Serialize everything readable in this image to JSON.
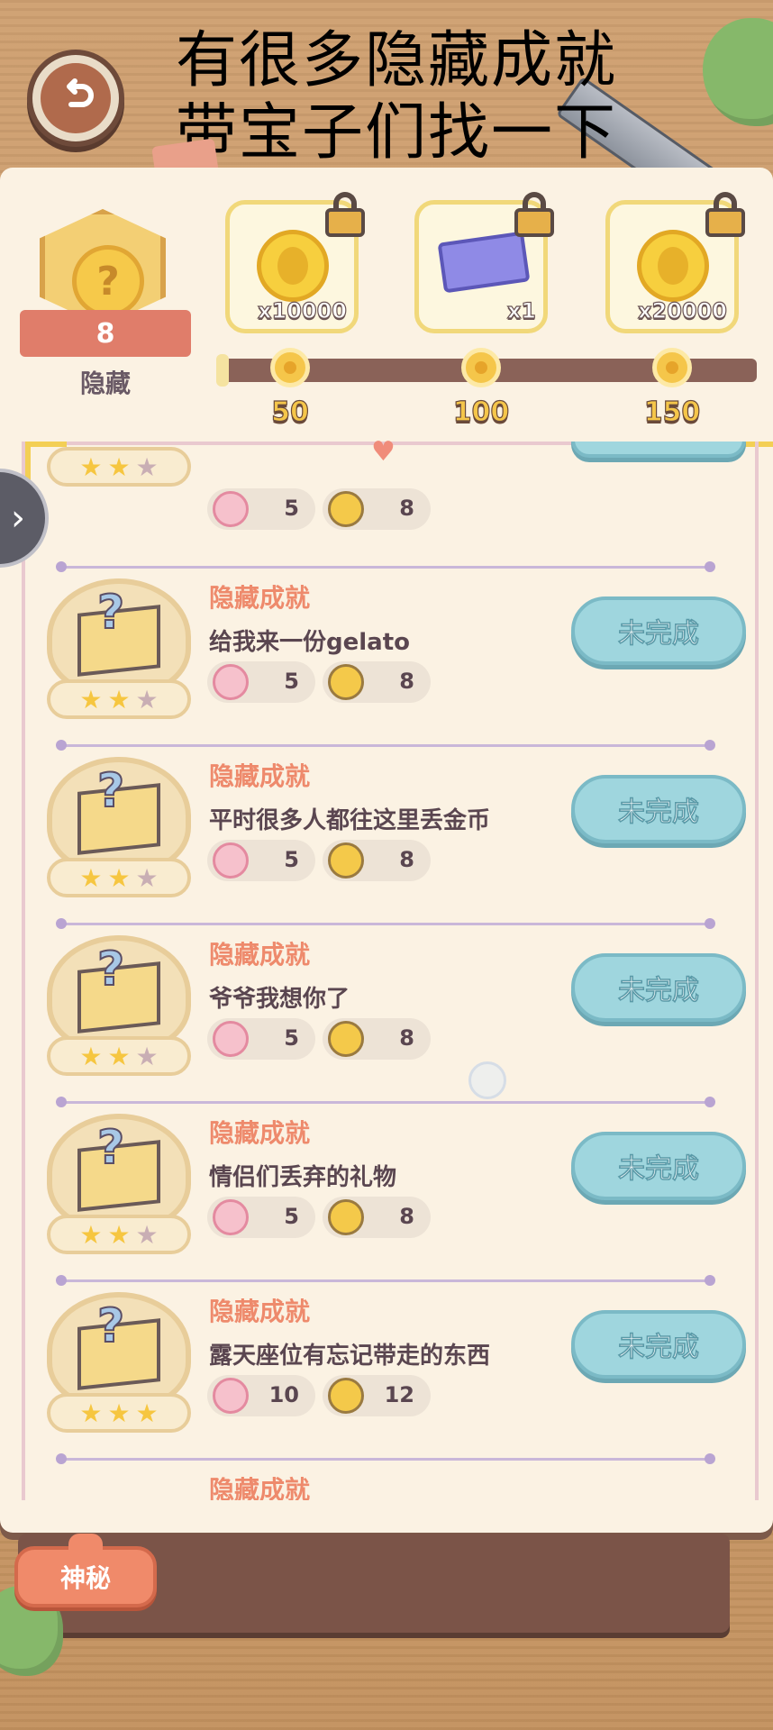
{
  "caption": {
    "line1": "有很多隐藏成就",
    "line2": "带宝子们找一下"
  },
  "badge": {
    "count": "8",
    "label": "隐藏"
  },
  "rewards": [
    {
      "qty": "x10000",
      "type": "coin",
      "locked": true
    },
    {
      "qty": "x1",
      "type": "ticket",
      "locked": true
    },
    {
      "qty": "x20000",
      "type": "coin",
      "locked": true
    }
  ],
  "milestones": [
    "50",
    "100",
    "150"
  ],
  "progress_value": 0,
  "partial_row": {
    "stars": [
      true,
      true,
      false
    ],
    "hearts": "5",
    "coins": "8"
  },
  "achievements": [
    {
      "title": "隐藏成就",
      "desc": "给我来一份gelato",
      "hearts": "5",
      "coins": "8",
      "status": "未完成",
      "stars": [
        true,
        true,
        false
      ]
    },
    {
      "title": "隐藏成就",
      "desc": "平时很多人都往这里丢金币",
      "hearts": "5",
      "coins": "8",
      "status": "未完成",
      "stars": [
        true,
        true,
        false
      ]
    },
    {
      "title": "隐藏成就",
      "desc": "爷爷我想你了",
      "hearts": "5",
      "coins": "8",
      "status": "未完成",
      "stars": [
        true,
        true,
        false
      ]
    },
    {
      "title": "隐藏成就",
      "desc": "情侣们丢弃的礼物",
      "hearts": "5",
      "coins": "8",
      "status": "未完成",
      "stars": [
        true,
        true,
        false
      ]
    },
    {
      "title": "隐藏成就",
      "desc": "露天座位有忘记带走的东西",
      "hearts": "10",
      "coins": "12",
      "status": "未完成",
      "stars": [
        true,
        true,
        true
      ]
    }
  ],
  "next_title": "隐藏成就",
  "tabs": {
    "mystery": "神秘"
  },
  "colors": {
    "accent_title": "#ee8a6c",
    "status_button": "#9fd6de",
    "panel": "#fbf2e3"
  }
}
